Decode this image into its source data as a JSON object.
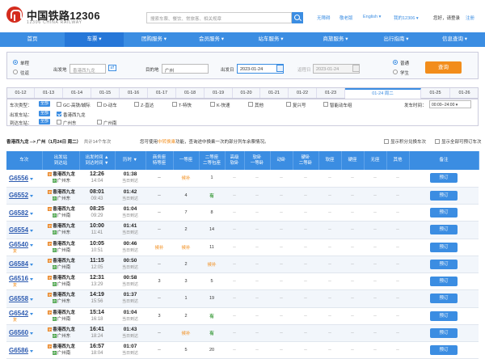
{
  "header": {
    "brand": "中国铁路12306",
    "brand_sub": "12306 CHINA RAILWAY",
    "search_placeholder": "搜索车票、餐饮、常旅客、相关规章",
    "links": [
      "无障碍",
      "敬老版",
      "English ▾",
      "我的12306 ▾",
      "您好，请登录",
      "注册"
    ]
  },
  "nav": [
    "首页",
    "车票 ▾",
    "团购服务 ▾",
    "会员服务 ▾",
    "站车服务 ▾",
    "商旅服务 ▾",
    "出行指南 ▾",
    "信息查询 ▾"
  ],
  "query": {
    "trip_types": [
      "单程",
      "往返"
    ],
    "from_label": "出发地",
    "from_value": "香港西九龙",
    "to_label": "目的地",
    "to_value": "广州",
    "depart_label": "出发日",
    "depart_value": "2023-01-24",
    "return_label": "返程日",
    "return_value": "2023-01-24",
    "passenger_types": [
      "普通",
      "学生"
    ],
    "search_button": "查询"
  },
  "dates": [
    "01-12",
    "01-13",
    "01-14",
    "01-15",
    "01-16",
    "01-17",
    "01-18",
    "01-19",
    "01-20",
    "01-21",
    "01-22",
    "01-23",
    "01-24 周二",
    "01-25",
    "01-26"
  ],
  "filters": {
    "type_label": "车次类型：",
    "all_tag": "全部",
    "types": [
      "GC-高铁/城际",
      "D-动车",
      "Z-直达",
      "T-特快",
      "K-快速",
      "其他",
      "复兴号",
      "智能动车组"
    ],
    "depart_station_label": "出发车站：",
    "depart_stations": [
      "香港西九龙"
    ],
    "arrive_station_label": "到达车站：",
    "arrive_stations": [
      "广州东",
      "广州南"
    ],
    "time_label": "发车时间：",
    "time_value": "00:00--24:00 ▾"
  },
  "summary": {
    "route": "香港西九龙 --> 广州（1月24日 周二）",
    "count": "共计14个车次",
    "hint_pre": "您可使用",
    "hint_link": "中转换乘",
    "hint_post": "功能，查询途中换乘一次的部分列车余票情况。",
    "opt1": "显示积分兑换车次",
    "opt2": "显示全部可预订车次"
  },
  "columns": [
    "车次",
    "出发站\n到达站",
    "出发时间 ▲\n到达时间 ▼",
    "历时 ▼",
    "商务座\n特等座",
    "一等座",
    "二等座\n二等包座",
    "高级\n软卧",
    "软卧\n一等卧",
    "动卧",
    "硬卧\n二等卧",
    "软座",
    "硬座",
    "无座",
    "其他",
    "备注"
  ],
  "trains": [
    {
      "no": "G6556",
      "from": "香港西九龙",
      "to": "广州东",
      "dep": "12:26",
      "arr": "14:04",
      "dur": "01:38",
      "dur_note": "当日到达",
      "biz": "--",
      "first": "候补",
      "second": "1",
      "tag": "",
      "book": "预订"
    },
    {
      "no": "G6552",
      "from": "香港西九龙",
      "to": "广州东",
      "dep": "08:01",
      "arr": "09:43",
      "dur": "01:42",
      "dur_note": "当日到达",
      "biz": "--",
      "first": "4",
      "second": "有",
      "tag": "",
      "book": "预订"
    },
    {
      "no": "G6582",
      "from": "香港西九龙",
      "to": "广州南",
      "dep": "08:25",
      "arr": "09:29",
      "dur": "01:04",
      "dur_note": "当日到达",
      "biz": "--",
      "first": "7",
      "second": "8",
      "tag": "",
      "book": "预订"
    },
    {
      "no": "G6554",
      "from": "香港西九龙",
      "to": "广州东",
      "dep": "10:00",
      "arr": "11:41",
      "dur": "01:41",
      "dur_note": "当日到达",
      "biz": "--",
      "first": "2",
      "second": "14",
      "tag": "",
      "book": "预订"
    },
    {
      "no": "G6540",
      "from": "香港西九龙",
      "to": "广州南",
      "dep": "10:05",
      "arr": "10:51",
      "dur": "00:46",
      "dur_note": "当日到达",
      "biz": "候补",
      "first": "候补",
      "second": "11",
      "tag": "复",
      "book": "预订"
    },
    {
      "no": "G6584",
      "from": "香港西九龙",
      "to": "广州南",
      "dep": "11:15",
      "arr": "12:05",
      "dur": "00:50",
      "dur_note": "当日到达",
      "biz": "--",
      "first": "2",
      "second": "候补",
      "tag": "",
      "book": "预订"
    },
    {
      "no": "G6516",
      "from": "香港西九龙",
      "to": "广州南",
      "dep": "12:31",
      "arr": "13:29",
      "dur": "00:58",
      "dur_note": "当日到达",
      "biz": "3",
      "first": "3",
      "second": "5",
      "tag": "复",
      "book": "预订"
    },
    {
      "no": "G6558",
      "from": "香港西九龙",
      "to": "广州东",
      "dep": "14:19",
      "arr": "15:56",
      "dur": "01:37",
      "dur_note": "当日到达",
      "biz": "--",
      "first": "1",
      "second": "19",
      "tag": "",
      "book": "预订"
    },
    {
      "no": "G6542",
      "from": "香港西九龙",
      "to": "广州南",
      "dep": "15:14",
      "arr": "16:18",
      "dur": "01:04",
      "dur_note": "当日到达",
      "biz": "3",
      "first": "2",
      "second": "有",
      "tag": "复",
      "book": "预订"
    },
    {
      "no": "G6560",
      "from": "香港西九龙",
      "to": "广州东",
      "dep": "16:41",
      "arr": "18:24",
      "dur": "01:43",
      "dur_note": "当日到达",
      "biz": "--",
      "first": "候补",
      "second": "有",
      "tag": "",
      "book": "预订"
    },
    {
      "no": "G6586",
      "from": "香港西九龙",
      "to": "广州南",
      "dep": "16:57",
      "arr": "18:04",
      "dur": "01:07",
      "dur_note": "当日到达",
      "biz": "--",
      "first": "5",
      "second": "20",
      "tag": "",
      "book": "预订"
    }
  ],
  "empty_cell": "--",
  "colors": {
    "primary": "#3b8de2",
    "accent": "#f28d1b",
    "available": "#3b9b3b",
    "brand": "#d42c1e"
  }
}
